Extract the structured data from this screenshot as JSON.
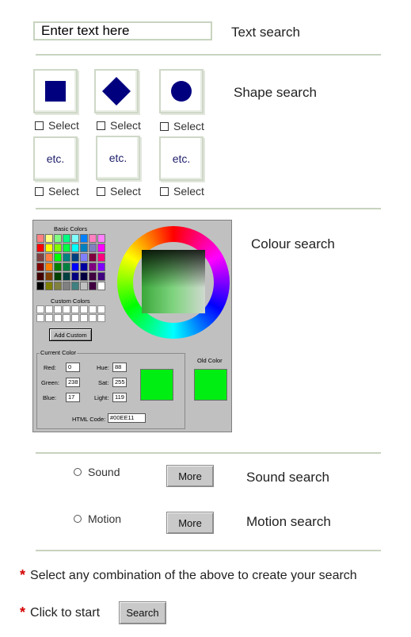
{
  "text_search": {
    "input_value": "Enter text here",
    "label": "Text search"
  },
  "shape_search": {
    "label": "Shape search",
    "select_label": "Select",
    "etc_label": "etc."
  },
  "colour_search": {
    "label": "Colour search",
    "dialog": {
      "basic_colors_label": "Basic Colors",
      "custom_colors_label": "Custom Colors",
      "add_custom_label": "Add Custom",
      "current_color_label": "Current Color",
      "old_color_label": "Old Color",
      "red_label": "Red:",
      "green_label": "Green:",
      "blue_label": "Blue:",
      "hue_label": "Hue:",
      "sat_label": "Sat:",
      "light_label": "Light:",
      "red_value": "0",
      "green_value": "238",
      "blue_value": "17",
      "hue_value": "88",
      "sat_value": "255",
      "light_value": "119",
      "html_code_label": "HTML Code:",
      "html_code_value": "#00EE11",
      "current_color_hex": "#00EE11"
    }
  },
  "sound_search": {
    "radio_label": "Sound",
    "more_label": "More",
    "label": "Sound search"
  },
  "motion_search": {
    "radio_label": "Motion",
    "more_label": "More",
    "label": "Motion search"
  },
  "notes": {
    "combine": "Select any combination of the above to create your search",
    "start": "Click to start",
    "search_button": "Search"
  },
  "colors": {
    "shape_fill": "#00007f",
    "divider": "#c7d3bf",
    "star": "#d40000"
  }
}
